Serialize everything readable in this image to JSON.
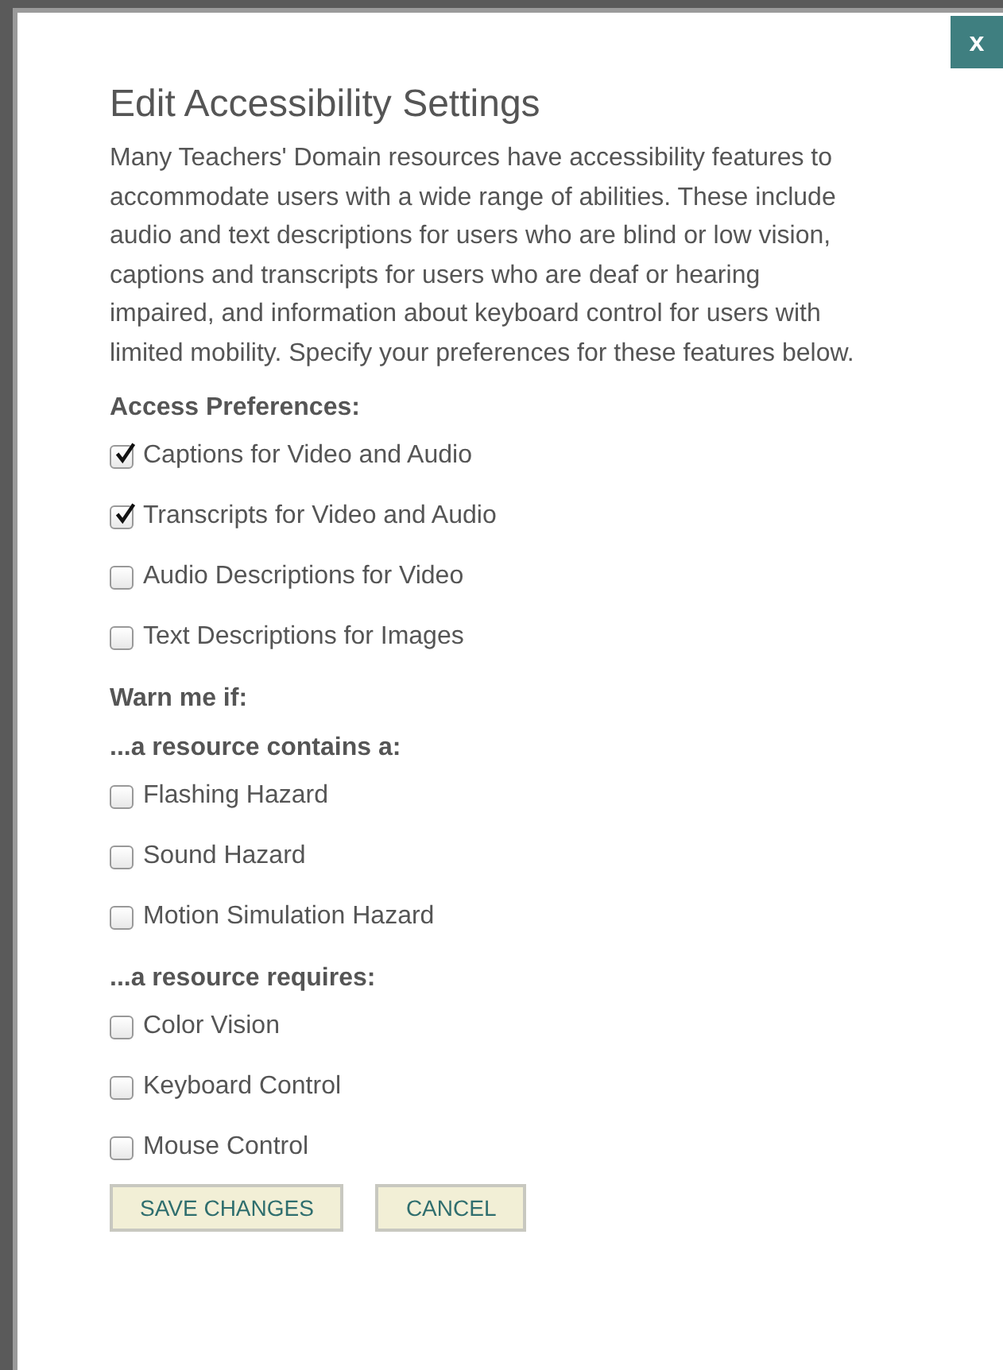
{
  "close_button": {
    "label": "x"
  },
  "title": "Edit Accessibility Settings",
  "description": "Many Teachers' Domain resources have accessibility features to accommodate users with a wide range of abilities. These include audio and text descriptions for users who are blind or low vision, captions and transcripts for users who are deaf or hearing impaired, and information about keyboard control for users with limited mobility. Specify your preferences for these features below.",
  "items": [
    {
      "kind": "heading",
      "text": "Access Preferences:"
    },
    {
      "kind": "checkbox",
      "text": "Captions for Video and Audio",
      "checked": true
    },
    {
      "kind": "checkbox",
      "text": "Transcripts for Video and Audio",
      "checked": true
    },
    {
      "kind": "checkbox",
      "text": "Audio Descriptions for Video",
      "checked": false
    },
    {
      "kind": "checkbox",
      "text": "Text Descriptions for Images",
      "checked": false
    },
    {
      "kind": "heading",
      "text": "Warn me if:"
    },
    {
      "kind": "heading",
      "text": "...a resource contains a:"
    },
    {
      "kind": "checkbox",
      "text": "Flashing Hazard",
      "checked": false
    },
    {
      "kind": "checkbox",
      "text": "Sound Hazard",
      "checked": false
    },
    {
      "kind": "checkbox",
      "text": "Motion Simulation Hazard",
      "checked": false
    },
    {
      "kind": "heading",
      "text": "...a resource requires:"
    },
    {
      "kind": "checkbox",
      "text": "Color Vision",
      "checked": false
    },
    {
      "kind": "checkbox",
      "text": "Keyboard Control",
      "checked": false
    },
    {
      "kind": "checkbox",
      "text": "Mouse Control",
      "checked": false
    }
  ],
  "buttons": [
    "SAVE CHANGES",
    "CANCEL"
  ]
}
